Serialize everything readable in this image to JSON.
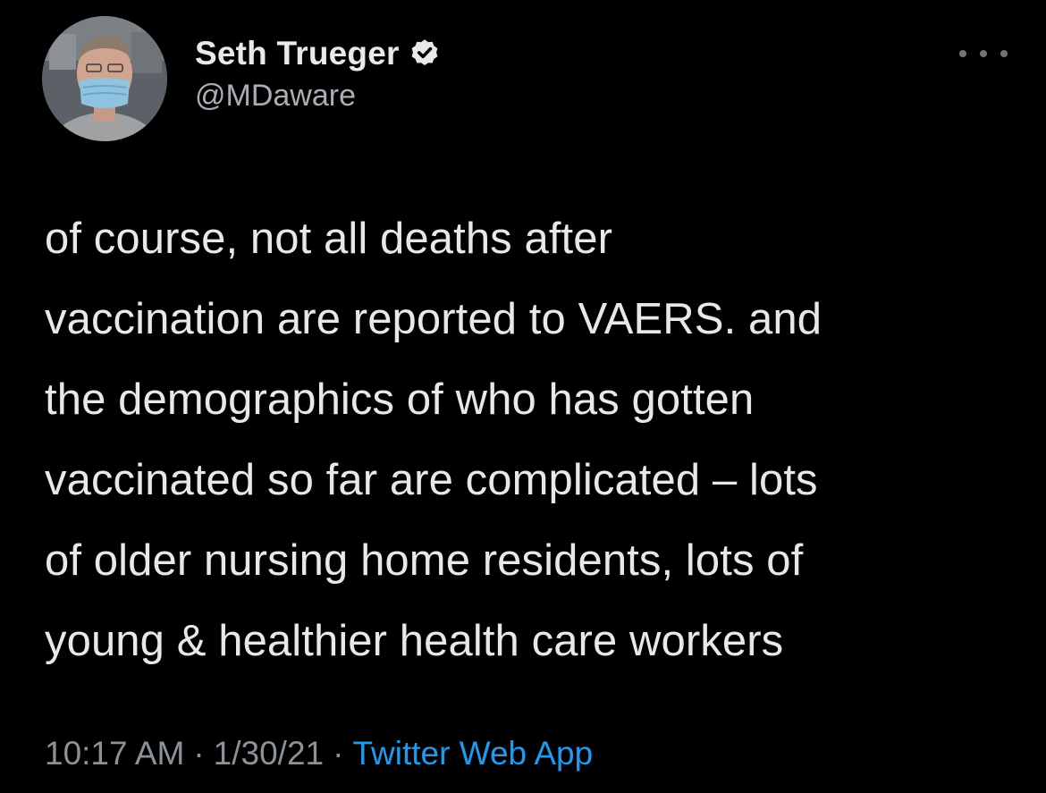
{
  "author": {
    "display_name": "Seth Trueger",
    "handle": "@MDaware",
    "verified": true
  },
  "icons": {
    "verified": "verified-badge-icon",
    "more": "more-options-icon"
  },
  "tweet": {
    "lines": [
      "of course, not all deaths after",
      "vaccination are reported to VAERS. and",
      "the demographics of who has gotten",
      "vaccinated so far are complicated – lots",
      "of older nursing home residents, lots of",
      "young & healthier health care workers"
    ]
  },
  "meta": {
    "time": "10:17 AM",
    "separator": "·",
    "date": "1/30/21",
    "source": "Twitter Web App"
  },
  "colors": {
    "background": "#000000",
    "text": "#e8e8e8",
    "muted": "#8b9298",
    "link": "#1d9bf0"
  }
}
